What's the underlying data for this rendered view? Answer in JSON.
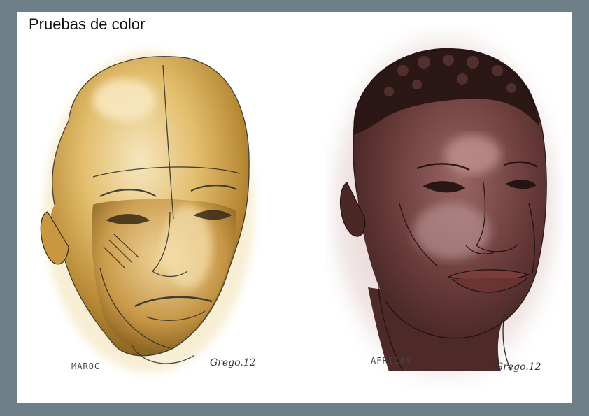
{
  "page": {
    "title": "Pruebas de color"
  },
  "left_panel": {
    "caption": "MAROC",
    "signature": "Grego.12",
    "palette": {
      "skin_light": "#f1d9a0",
      "skin_mid": "#d9ae5a",
      "skin_dark": "#a8782a",
      "shadow": "#7a5316"
    }
  },
  "right_panel": {
    "caption": "AFRICAN",
    "signature": "Grego.12",
    "palette": {
      "skin_light": "#c9a3a0",
      "skin_mid": "#7a4a48",
      "skin_dark": "#4a2826",
      "hair": "#2b1816",
      "halo": "#b58f8d"
    }
  },
  "colors": {
    "frame": "#6f7f88",
    "sheet": "#ffffff",
    "line": "#2a2a2a"
  }
}
